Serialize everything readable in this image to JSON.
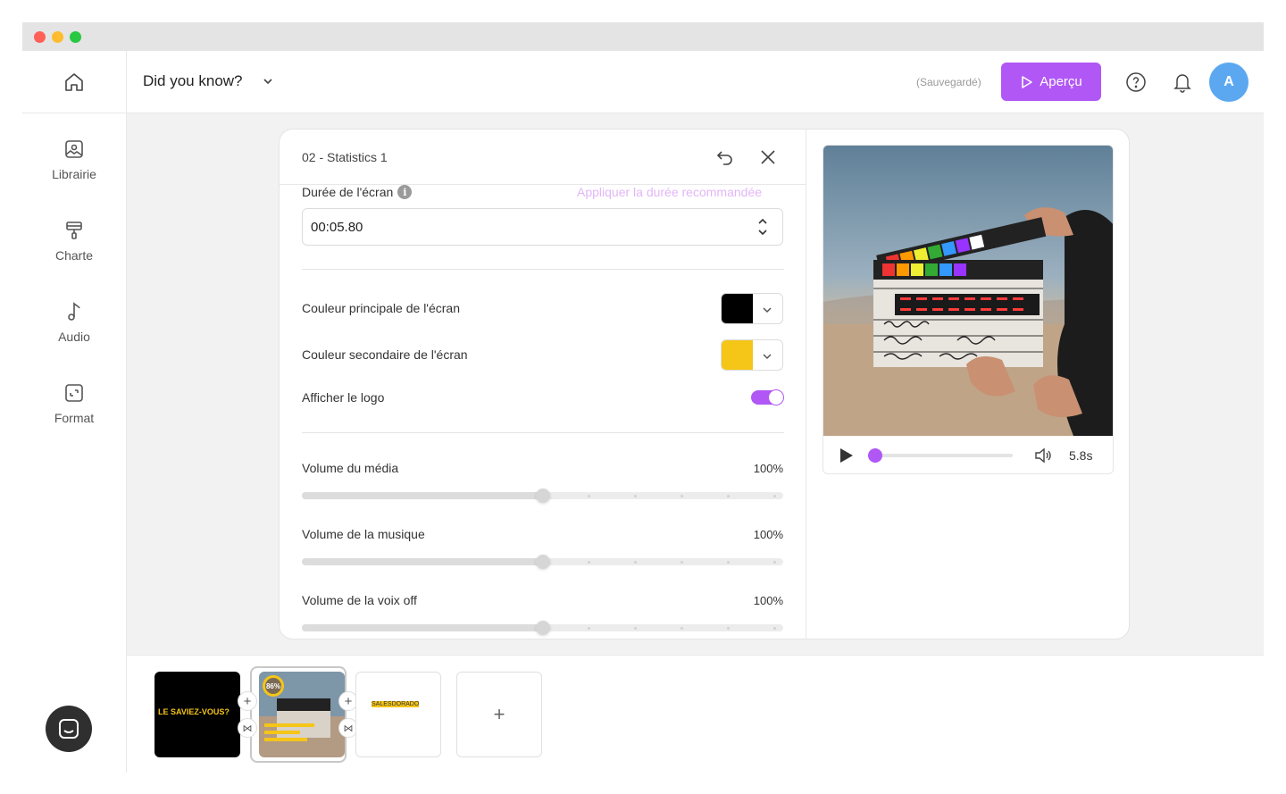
{
  "sidebar": {
    "items": [
      {
        "label": "Librairie",
        "icon": "image-icon"
      },
      {
        "label": "Charte",
        "icon": "paint-roller-icon"
      },
      {
        "label": "Audio",
        "icon": "music-note-icon"
      },
      {
        "label": "Format",
        "icon": "resize-icon"
      }
    ]
  },
  "topbar": {
    "project_title": "Did you know?",
    "save_status": "(Sauvegardé)",
    "preview_label": "Aperçu",
    "avatar_initial": "A",
    "accent_color": "#b057f5"
  },
  "panel": {
    "title": "02 - Statistics 1",
    "duration_label": "Durée de l'écran",
    "apply_recommended": "Appliquer la durée recommandée",
    "duration_value": "00:05.80",
    "primary_color_label": "Couleur principale de l'écran",
    "primary_color": "#000000",
    "secondary_color_label": "Couleur secondaire de l'écran",
    "secondary_color": "#f5c518",
    "show_logo_label": "Afficher le logo",
    "show_logo_on": true,
    "volumes": [
      {
        "label": "Volume du média",
        "value": "100%",
        "level": 0.5
      },
      {
        "label": "Volume de la musique",
        "value": "100%",
        "level": 0.5
      },
      {
        "label": "Volume de la voix off",
        "value": "100%",
        "level": 0.5
      }
    ]
  },
  "preview": {
    "duration": "5.8s",
    "progress": 0
  },
  "timeline": {
    "slide1_text": "LE SAVIEZ-VOUS?",
    "slide2_badge": "86%",
    "slide3_logo": "SALESDORADO",
    "add_label": "+"
  }
}
